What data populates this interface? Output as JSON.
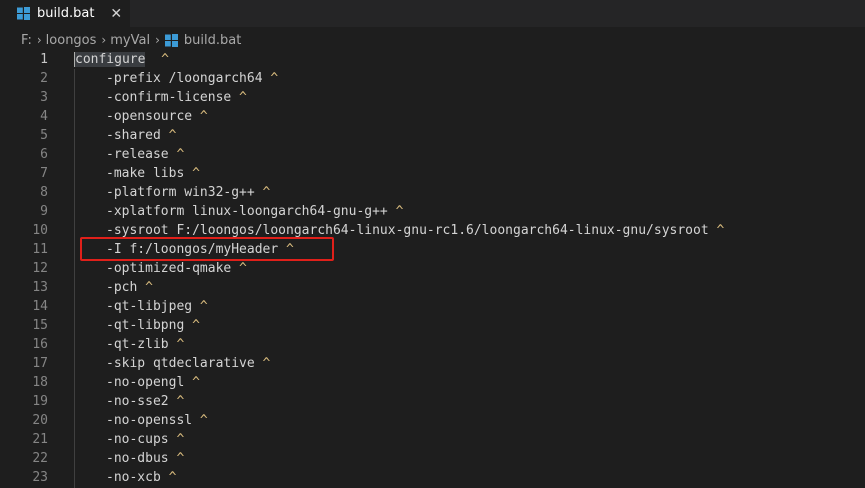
{
  "tab": {
    "label": "build.bat",
    "close_glyph": "✕",
    "icon": "windows-icon"
  },
  "breadcrumb": {
    "items": [
      "F:",
      "loongos",
      "myVal",
      "build.bat"
    ],
    "separator": "›"
  },
  "editor": {
    "lines": [
      {
        "n": "1",
        "text": "configure",
        "caret": "  ^"
      },
      {
        "n": "2",
        "text": "-prefix /loongarch64",
        "caret": " ^"
      },
      {
        "n": "3",
        "text": "-confirm-license",
        "caret": " ^"
      },
      {
        "n": "4",
        "text": "-opensource",
        "caret": " ^"
      },
      {
        "n": "5",
        "text": "-shared",
        "caret": " ^"
      },
      {
        "n": "6",
        "text": "-release",
        "caret": " ^"
      },
      {
        "n": "7",
        "text": "-make libs",
        "caret": " ^"
      },
      {
        "n": "8",
        "text": "-platform win32-g++",
        "caret": " ^"
      },
      {
        "n": "9",
        "text": "-xplatform linux-loongarch64-gnu-g++",
        "caret": " ^"
      },
      {
        "n": "10",
        "text": "-sysroot F:/loongos/loongarch64-linux-gnu-rc1.6/loongarch64-linux-gnu/sysroot",
        "caret": " ^"
      },
      {
        "n": "11",
        "text": "-I f:/loongos/myHeader",
        "caret": " ^"
      },
      {
        "n": "12",
        "text": "-optimized-qmake",
        "caret": " ^"
      },
      {
        "n": "13",
        "text": "-pch",
        "caret": " ^"
      },
      {
        "n": "14",
        "text": "-qt-libjpeg",
        "caret": " ^"
      },
      {
        "n": "15",
        "text": "-qt-libpng",
        "caret": " ^"
      },
      {
        "n": "16",
        "text": "-qt-zlib",
        "caret": " ^"
      },
      {
        "n": "17",
        "text": "-skip qtdeclarative",
        "caret": " ^"
      },
      {
        "n": "18",
        "text": "-no-opengl",
        "caret": " ^"
      },
      {
        "n": "19",
        "text": "-no-sse2",
        "caret": " ^"
      },
      {
        "n": "20",
        "text": "-no-openssl",
        "caret": " ^"
      },
      {
        "n": "21",
        "text": "-no-cups",
        "caret": " ^"
      },
      {
        "n": "22",
        "text": "-no-dbus",
        "caret": " ^"
      },
      {
        "n": "23",
        "text": "-no-xcb",
        "caret": " ^"
      }
    ],
    "highlighted_line": 11
  },
  "colors": {
    "background": "#1e1e1e",
    "line_number": "#858585",
    "code_text": "#d4d4d4",
    "caret": "#d7ba7d",
    "highlight_box": "#e0201a",
    "icon_blue": "#3c9bd6"
  }
}
